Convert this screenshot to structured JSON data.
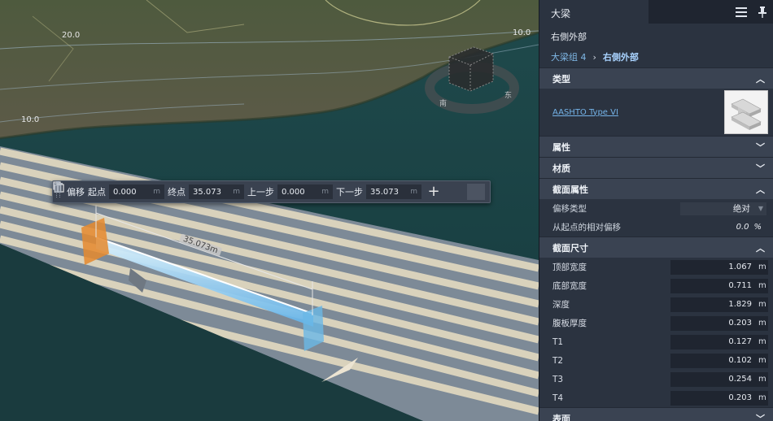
{
  "viewport": {
    "contour_labels": [
      "20.0",
      "10.0",
      "10.0"
    ],
    "nav_cube": {
      "south": "南",
      "east": "东"
    },
    "dimension_label": "35.073m"
  },
  "toolbar": {
    "offset_label": "偏移",
    "start_label": "起点",
    "start_value": "0.000",
    "end_label": "终点",
    "end_value": "35.073",
    "prev_label": "上一步",
    "prev_value": "0.000",
    "next_label": "下一步",
    "next_value": "35.073",
    "unit": "m",
    "add_icon": "+",
    "copy_icon": "copy",
    "delete_icon": "trash"
  },
  "panel": {
    "tab_title": "大梁",
    "subtitle": "右側外部",
    "breadcrumb": {
      "parent": "大梁组 4",
      "separator": "›",
      "current": "右側外部"
    },
    "sections": {
      "type": "类型",
      "properties": "属性",
      "material": "材质",
      "section_props": "截面属性",
      "section_dims": "截面尺寸",
      "next": "表面"
    },
    "type_link": "AASHTO Type VI",
    "offset_type_label": "偏移类型",
    "offset_type_value": "绝对",
    "relative_offset_label": "从起点的相对偏移",
    "relative_offset_value": "0.0",
    "relative_offset_unit": "%",
    "dims": [
      {
        "label": "顶部宽度",
        "value": "1.067",
        "unit": "m"
      },
      {
        "label": "底部宽度",
        "value": "0.711",
        "unit": "m"
      },
      {
        "label": "深度",
        "value": "1.829",
        "unit": "m"
      },
      {
        "label": "腹板厚度",
        "value": "0.203",
        "unit": "m"
      },
      {
        "label": "T1",
        "value": "0.127",
        "unit": "m"
      },
      {
        "label": "T2",
        "value": "0.102",
        "unit": "m"
      },
      {
        "label": "T3",
        "value": "0.254",
        "unit": "m"
      },
      {
        "label": "T4",
        "value": "0.203",
        "unit": "m"
      }
    ]
  }
}
